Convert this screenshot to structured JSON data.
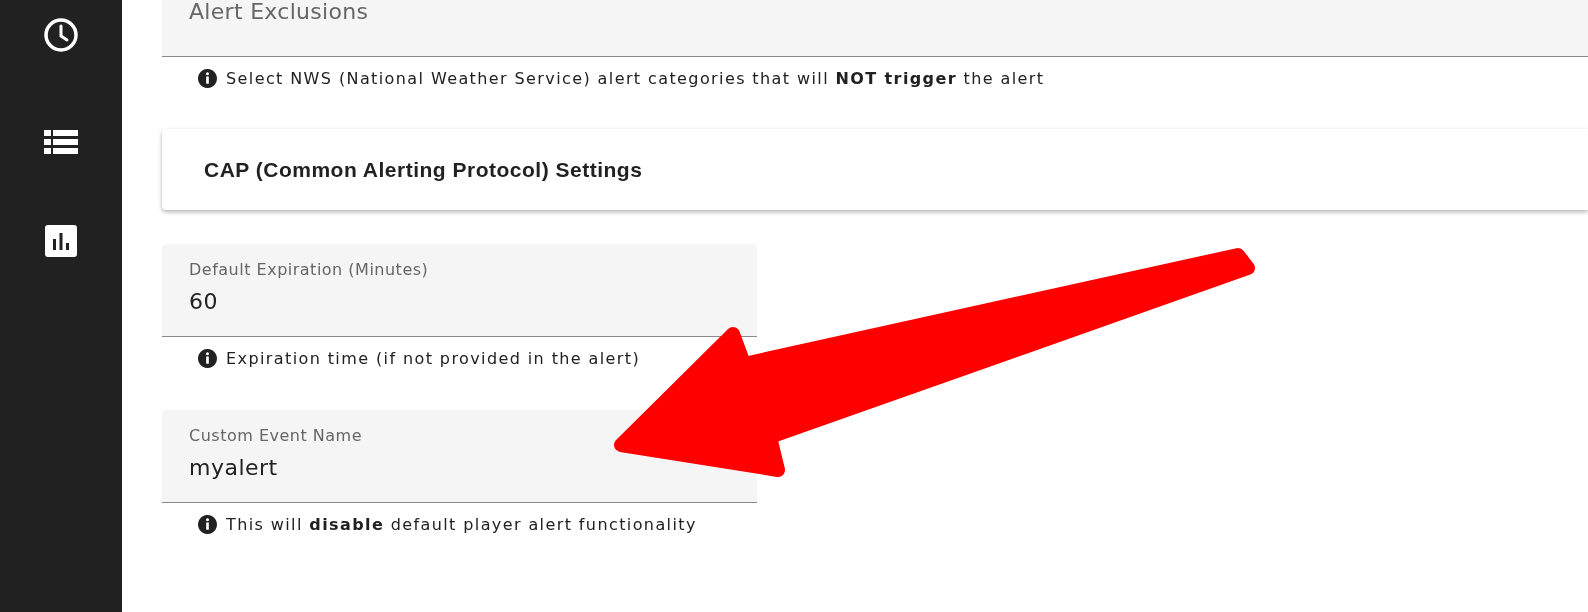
{
  "form": [
    {
      "kind": "field",
      "label": "Alert Exclusions",
      "full_width": true
    },
    {
      "kind": "help",
      "text": "Select NWS (National Weather Service) alert categories that will **NOT trigger** the alert"
    },
    {
      "kind": "panel",
      "title": "CAP (Common Alerting Protocol) Settings"
    },
    {
      "kind": "field",
      "label": "Default Expiration (Minutes)",
      "value": "60",
      "full_width": false
    },
    {
      "kind": "help",
      "text": "Expiration time (if not provided in the alert)"
    },
    {
      "kind": "field",
      "label": "Custom Event Name",
      "value": "myalert",
      "full_width": false
    },
    {
      "kind": "help",
      "text": "This will **disable** default player alert functionality"
    }
  ]
}
